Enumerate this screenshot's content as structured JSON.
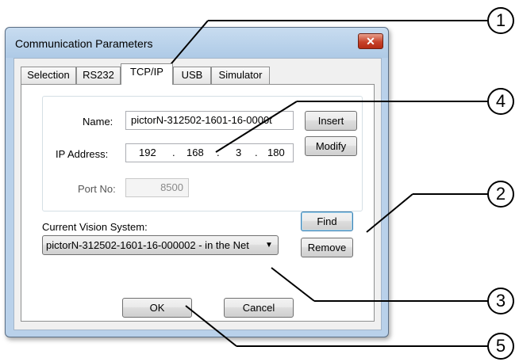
{
  "window": {
    "title": "Communication Parameters",
    "close_glyph": "✕"
  },
  "tabs": [
    {
      "label": "Selection"
    },
    {
      "label": "RS232"
    },
    {
      "label": "TCP/IP",
      "active": true
    },
    {
      "label": "USB"
    },
    {
      "label": "Simulator"
    }
  ],
  "tcpip": {
    "name_label": "Name:",
    "name_value": "pictorN-312502-1601-16-0000t",
    "ip_label": "IP Address:",
    "ip_octets": [
      "192",
      "168",
      "3",
      "180"
    ],
    "ip_separator": ".",
    "port_label": "Port No:",
    "port_value": "8500",
    "insert_label": "Insert",
    "modify_label": "Modify"
  },
  "vision": {
    "label": "Current Vision System:",
    "selected": "pictorN-312502-1601-16-000002 - in the Net",
    "find_label": "Find",
    "remove_label": "Remove"
  },
  "footer": {
    "ok_label": "OK",
    "cancel_label": "Cancel"
  },
  "callouts": [
    "1",
    "2",
    "3",
    "4",
    "5"
  ],
  "colors": {
    "title_bar": "#b9d1ea",
    "close_button": "#c7432a",
    "focus_border": "#3c7fb1"
  }
}
